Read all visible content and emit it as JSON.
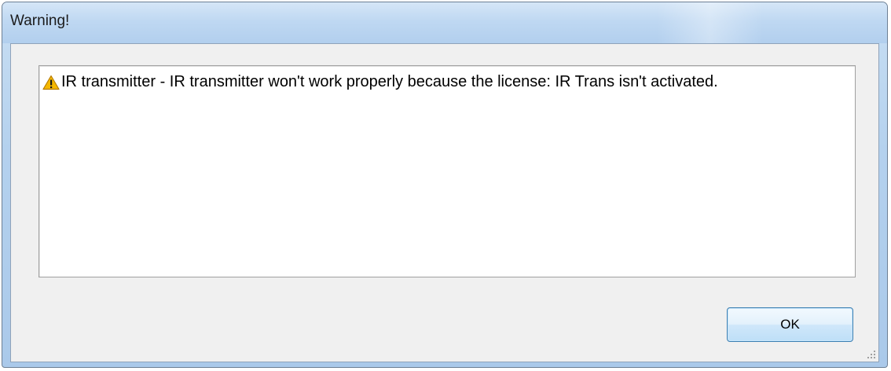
{
  "window": {
    "title": "Warning!"
  },
  "message": {
    "icon": "warning-icon",
    "text": "IR transmitter - IR transmitter won't work properly because the license: IR Trans isn't activated."
  },
  "buttons": {
    "ok_label": "OK"
  },
  "colors": {
    "titlebar": "#b8d4f0",
    "client_background": "#f0f0f0",
    "ok_button_border": "#3c7fb1",
    "warning_icon": "#f5b800"
  }
}
